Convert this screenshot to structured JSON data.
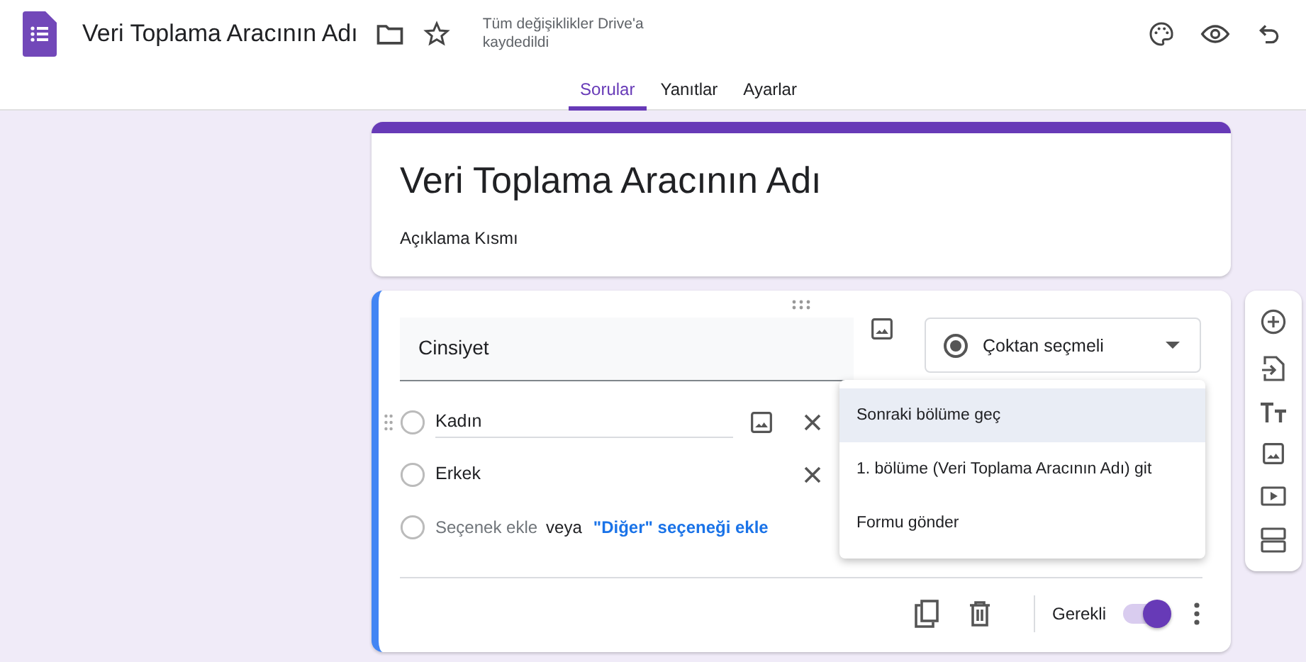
{
  "header": {
    "title": "Veri Toplama Aracının Adı",
    "save_status": "Tüm değişiklikler Drive'a kaydedildi"
  },
  "tabs": [
    {
      "label": "Sorular",
      "selected": true
    },
    {
      "label": "Yanıtlar",
      "selected": false
    },
    {
      "label": "Ayarlar",
      "selected": false
    }
  ],
  "form": {
    "title": "Veri Toplama Aracının Adı",
    "description": "Açıklama Kısmı"
  },
  "question": {
    "title": "Cinsiyet",
    "type_label": "Çoktan seçmeli",
    "options": [
      {
        "label": "Kadın",
        "focused": true
      },
      {
        "label": "Erkek",
        "focused": false
      }
    ],
    "add_option": "Seçenek ekle",
    "or_text": "veya",
    "add_other": "\"Diğer\" seçeneği ekle",
    "required_label": "Gerekli",
    "required": true
  },
  "menu": {
    "items": [
      {
        "label": "Sonraki bölüme geç",
        "selected": true
      },
      {
        "label": "1. bölüme (Veri Toplama Aracının Adı) git",
        "selected": false
      },
      {
        "label": "Formu gönder",
        "selected": false
      }
    ]
  }
}
